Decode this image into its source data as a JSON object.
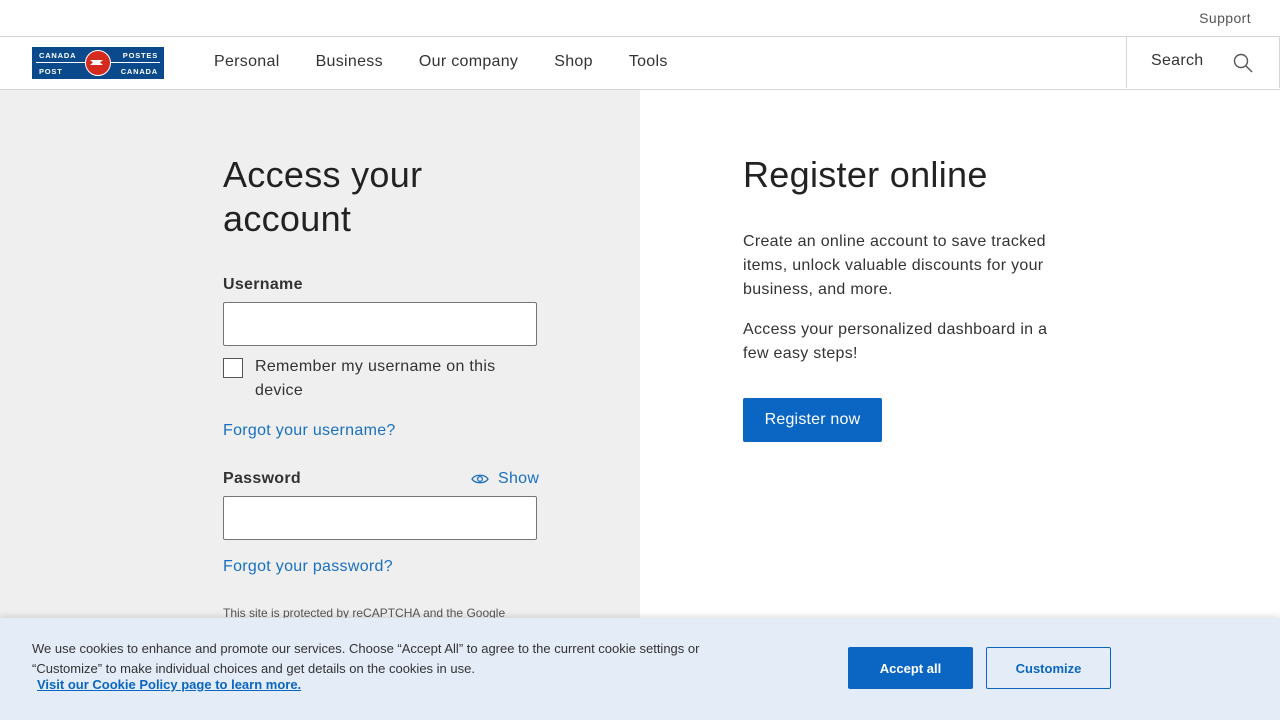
{
  "utility": {
    "support": "Support"
  },
  "logo": {
    "top_left": "CANADA",
    "top_right": "POSTES",
    "bottom_left": "POST",
    "bottom_right": "CANADA",
    "colors": {
      "background": "#0a4a8c",
      "emblem": "#d52b1e"
    }
  },
  "nav": {
    "items": [
      {
        "label": "Personal"
      },
      {
        "label": "Business"
      },
      {
        "label": "Our company"
      },
      {
        "label": "Shop"
      },
      {
        "label": "Tools"
      }
    ],
    "search_label": "Search",
    "search_icon": "search-icon"
  },
  "login": {
    "title": "Access your account",
    "username_label": "Username",
    "username_value": "",
    "remember_label": "Remember my username on this device",
    "remember_checked": false,
    "forgot_username": "Forgot your username?",
    "password_label": "Password",
    "password_value": "",
    "show_label": "Show",
    "show_icon": "eye-icon",
    "forgot_password": "Forgot your password?",
    "recaptcha": "This site is protected by reCAPTCHA and the Google"
  },
  "register": {
    "title": "Register online",
    "paragraph1": "Create an online account to save tracked items, unlock valuable discounts for your business, and more.",
    "paragraph2": "Access your personalized dashboard in a few easy steps!",
    "button": "Register now"
  },
  "cookie": {
    "text": "We use cookies to enhance and promote our services. Choose “Accept All” to agree to the current cookie settings or “Customize” to make individual choices and get details on the cookies in use.",
    "link": "Visit our Cookie Policy page to learn more.",
    "accept": "Accept all",
    "customize": "Customize"
  },
  "colors": {
    "accent": "#0a66c2",
    "link": "#1a6fbf",
    "left_panel": "#efefef",
    "cookie_banner": "#e4ecf7"
  }
}
